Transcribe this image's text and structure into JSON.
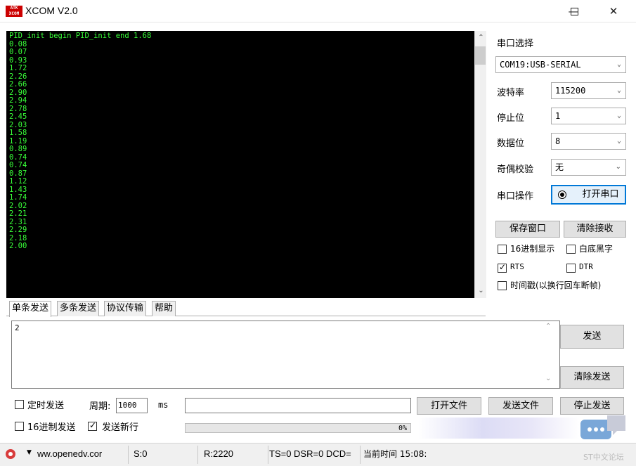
{
  "window": {
    "title": "XCOM V2.0",
    "icon_text": "ATK XCOM",
    "minimize_icon": "minimize-icon",
    "maximize_icon": "maximize-icon",
    "close_icon": "close-icon"
  },
  "terminal": {
    "lines": [
      "PID_init begin PID_init end 1.68",
      "0.08",
      "0.07",
      "0.93",
      "1.72",
      "2.26",
      "2.66",
      "2.90",
      "2.94",
      "2.78",
      "2.45",
      "2.03",
      "1.58",
      "1.19",
      "0.89",
      "0.74",
      "0.74",
      "0.87",
      "1.12",
      "1.43",
      "1.74",
      "2.02",
      "2.21",
      "2.31",
      "2.29",
      "2.18",
      "2.00"
    ],
    "text_color": "#39ff39",
    "background": "#000000"
  },
  "serial": {
    "port_select_label": "串口选择",
    "port_value": "COM19:USB-SERIAL",
    "baud_label": "波特率",
    "baud_value": "115200",
    "stopbits_label": "停止位",
    "stopbits_value": "1",
    "databits_label": "数据位",
    "databits_value": "8",
    "parity_label": "奇偶校验",
    "parity_value": "无",
    "operation_label": "串口操作",
    "open_button": "打开串口",
    "save_window_button": "保存窗口",
    "clear_receive_button": "清除接收",
    "hex_display": {
      "label": "16进制显示",
      "checked": false
    },
    "white_bg": {
      "label": "白底黑字",
      "checked": false
    },
    "rts": {
      "label": "RTS",
      "checked": true
    },
    "dtr": {
      "label": "DTR",
      "checked": false
    },
    "timestamp": {
      "label": "时间戳(以换行回车断帧)",
      "checked": false
    }
  },
  "tabs": [
    "单条发送",
    "多条发送",
    "协议传输",
    "帮助"
  ],
  "send": {
    "text": "2",
    "send_button": "发送",
    "clear_send_button": "清除发送",
    "timed_send": {
      "label": "定时发送",
      "checked": false
    },
    "period_label": "周期:",
    "period_value": "1000",
    "period_unit": "ms",
    "file_path": "",
    "open_file_button": "打开文件",
    "send_file_button": "发送文件",
    "stop_send_button": "停止发送",
    "hex_send": {
      "label": "16进制发送",
      "checked": false
    },
    "send_newline": {
      "label": "发送新行",
      "checked": true
    },
    "progress_percent": 0,
    "progress_label": "0%"
  },
  "statusbar": {
    "url": "ww.openedv.cor",
    "sent": "S:0",
    "received": "R:2220",
    "signals": "TS=0 DSR=0 DCD=",
    "time": "当前时间 15:08:"
  },
  "watermark": "ST中文论坛"
}
